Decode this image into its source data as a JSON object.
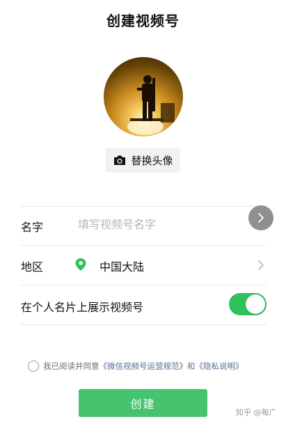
{
  "header": {
    "title": "创建视频号"
  },
  "avatar": {
    "change_label": "替换头像"
  },
  "form": {
    "name_label": "名字",
    "name_placeholder": "填写视频号名字",
    "name_value": "",
    "region_label": "地区",
    "region_value": "中国大陆",
    "show_on_card_label": "在个人名片上展示视频号",
    "show_on_card_enabled": true
  },
  "agreement": {
    "prefix": "我已阅读并同意",
    "terms_link": "《微信视频号运营规范》",
    "and": "和",
    "privacy_link": "《隐私说明》",
    "checked": false
  },
  "actions": {
    "create_label": "创建"
  },
  "watermark": {
    "text": "知乎 @每广"
  },
  "colors": {
    "accent": "#2fc15b",
    "button": "#45c36d",
    "link": "#576b95"
  }
}
